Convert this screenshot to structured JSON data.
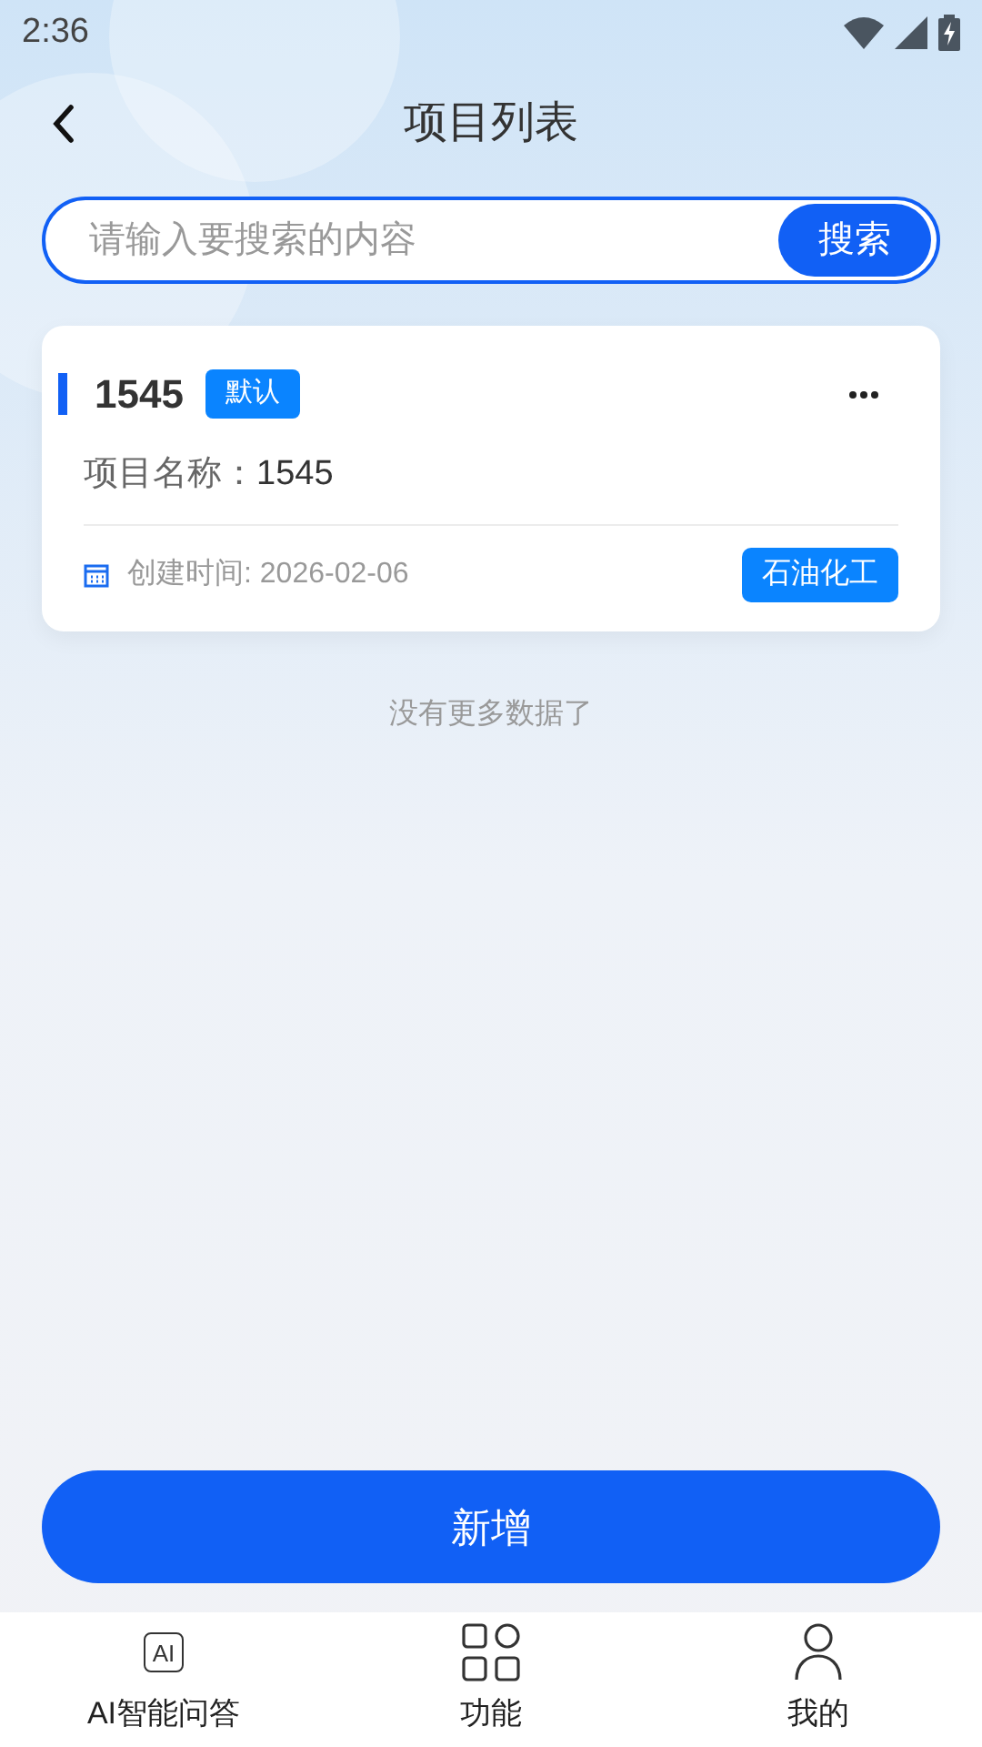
{
  "status_bar": {
    "time": "2:36"
  },
  "header": {
    "title": "项目列表"
  },
  "search": {
    "placeholder": "请输入要搜索的内容",
    "button": "搜索"
  },
  "projects": [
    {
      "number": "1545",
      "badge": "默认",
      "name_label": "项目名称：",
      "name": "1545",
      "created": "创建时间: 2026-02-06",
      "category": "石油化工"
    }
  ],
  "end_note": "没有更多数据了",
  "add_button": "新增",
  "tab_bar": [
    {
      "kind": "ai",
      "icon_text": "AI",
      "label": "AI智能问答"
    },
    {
      "kind": "grid",
      "label": "功能"
    },
    {
      "kind": "person",
      "label": "我的"
    }
  ]
}
